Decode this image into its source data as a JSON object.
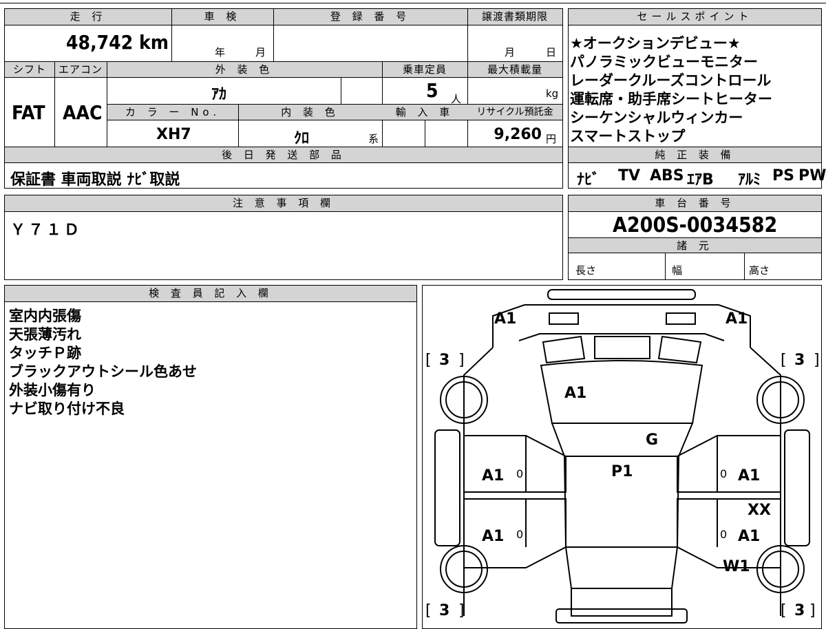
{
  "spec": {
    "headers": {
      "mileage": "走 行",
      "inspection": "車 検",
      "reg_number": "登 録 番 号",
      "transfer_deadline": "譲渡書類期限",
      "shift": "シフト",
      "aircon": "エアコン",
      "exterior_color": "外 装 色",
      "capacity": "乗車定員",
      "max_load": "最大積載量",
      "color_no": "カ ラ ー No.",
      "interior_color": "内 装 色",
      "import": "輸 入 車",
      "recycle": "リサイクル預託金",
      "later_parts": "後 日 発 送 部 品"
    },
    "mileage": "48,742 km",
    "inspection_year_unit": "年",
    "inspection_month_unit": "月",
    "transfer_month_unit": "月",
    "transfer_day_unit": "日",
    "shift": "FAT",
    "aircon": "AAC",
    "exterior_color": "ｱｶ",
    "capacity": "5",
    "capacity_unit": "人",
    "load_unit": "kg",
    "color_no": "XH7",
    "interior_color": "ｸﾛ",
    "interior_suffix": "系",
    "recycle_fee": "9,260",
    "recycle_unit": "円",
    "later_parts": "保証書 車両取説 ﾅﾋﾞ取説"
  },
  "sales": {
    "header": "セールスポイント",
    "points": [
      "★オークションデビュー★",
      "パノラミックビューモニター",
      "レーダークルーズコントロール",
      "運転席・助手席シートヒーター",
      "シーケンシャルウィンカー",
      "スマートストップ"
    ],
    "equip_header": "純 正 装 備",
    "equipment": [
      "ﾅﾋﾞ",
      "TV",
      "ABS",
      "ｴｱB",
      "ｱﾙﾐ",
      "PS",
      "PW"
    ]
  },
  "notes": {
    "header": "注 意 事 項 欄",
    "text": "Ｙ７１Ｄ"
  },
  "chassis": {
    "header": "車 台 番 号",
    "number": "A200S-0034582",
    "spec_header": "諸 元",
    "length": "長さ",
    "width": "幅",
    "height": "高さ"
  },
  "inspector": {
    "header": "検 査 員 記 入 欄",
    "lines": [
      "室内内張傷",
      "天張薄汚れ",
      "タッチＰ跡",
      "ブラックアウトシール色あせ",
      "外装小傷有り",
      "ナビ取り付け不良"
    ]
  },
  "diagram": {
    "tread_open": "[",
    "tread_close": "]",
    "tread_values": {
      "front_left": "3",
      "front_right": "3",
      "rear_left": "3",
      "rear_right": "3"
    },
    "marks": {
      "front_left": "A1",
      "front_right": "A1",
      "hood": "A1",
      "windshield": "G",
      "roof": "P1",
      "left_front_door": "A1",
      "left_rear_door": "A1",
      "right_front_door": "A1",
      "right_rear_door": "A1",
      "right_quarter": "XX",
      "right_rear_wheel": "W1",
      "small_lf": "0",
      "small_lr": "0",
      "small_rf": "0",
      "small_rr": "0"
    }
  }
}
